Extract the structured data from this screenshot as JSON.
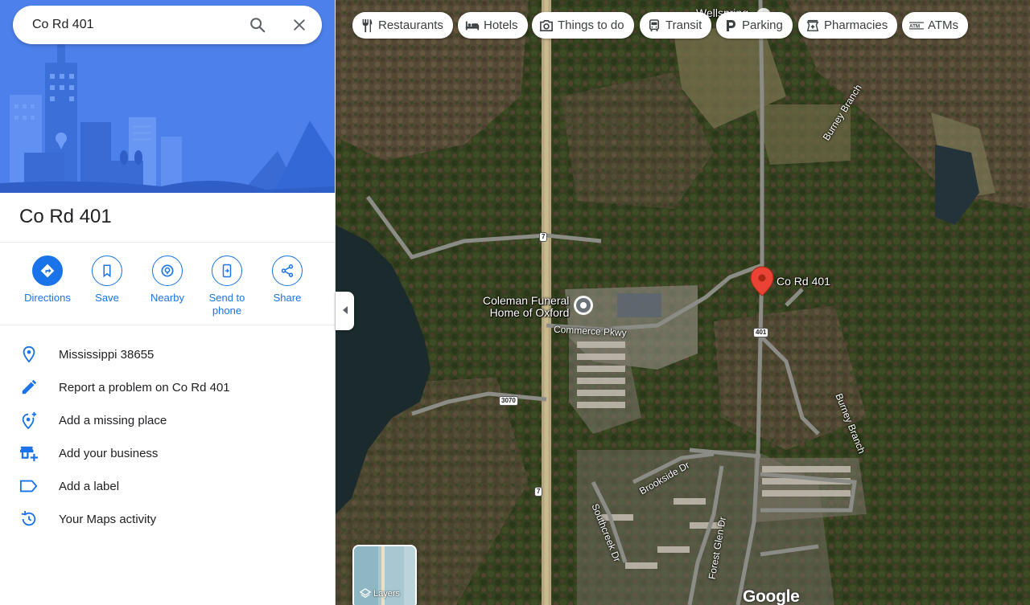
{
  "search": {
    "value": "Co Rd 401",
    "search_icon": "search-icon",
    "close_icon": "close-icon"
  },
  "place": {
    "title": "Co Rd 401"
  },
  "actions": [
    {
      "label": "Directions",
      "icon": "directions-icon"
    },
    {
      "label": "Save",
      "icon": "bookmark-icon"
    },
    {
      "label": "Nearby",
      "icon": "nearby-icon"
    },
    {
      "label": "Send to phone",
      "icon": "send-to-phone-icon"
    },
    {
      "label": "Share",
      "icon": "share-icon"
    }
  ],
  "info_rows": [
    {
      "text": "Mississippi 38655",
      "icon": "location-pin-icon"
    },
    {
      "text": "Report a problem on Co Rd 401",
      "icon": "pencil-icon"
    },
    {
      "text": "Add a missing place",
      "icon": "add-location-icon"
    },
    {
      "text": "Add your business",
      "icon": "add-business-icon"
    },
    {
      "text": "Add a label",
      "icon": "label-icon"
    },
    {
      "text": "Your Maps activity",
      "icon": "history-icon"
    }
  ],
  "chips": [
    {
      "label": "Restaurants",
      "icon": "fork-knife-icon"
    },
    {
      "label": "Hotels",
      "icon": "bed-icon"
    },
    {
      "label": "Things to do",
      "icon": "camera-icon"
    },
    {
      "label": "Transit",
      "icon": "bus-icon"
    },
    {
      "label": "Parking",
      "icon": "parking-icon"
    },
    {
      "label": "Pharmacies",
      "icon": "pharmacy-icon"
    },
    {
      "label": "ATMs",
      "icon": "atm-icon"
    }
  ],
  "map": {
    "pin_label": "Co Rd 401",
    "poi_label_line1": "Coleman Funeral",
    "poi_label_line2": "Home of Oxford",
    "top_label": "Wellspring",
    "roads": {
      "commerce": "Commerce Pkwy",
      "burney_top": "Burney Branch",
      "burney_bottom": "Burney Branch",
      "brookside": "Brookside Dr",
      "southcreek": "Southcreek Dr",
      "forest_glen": "Forest Glen Dr"
    },
    "shields": {
      "hwy7_top": "7",
      "hwy7_bottom": "7",
      "cr401": "401",
      "cr3070": "3070"
    },
    "layers_label": "Layers",
    "logo": "Google",
    "colors": {
      "pin": "#ea4335",
      "accent": "#1a73e8"
    }
  }
}
